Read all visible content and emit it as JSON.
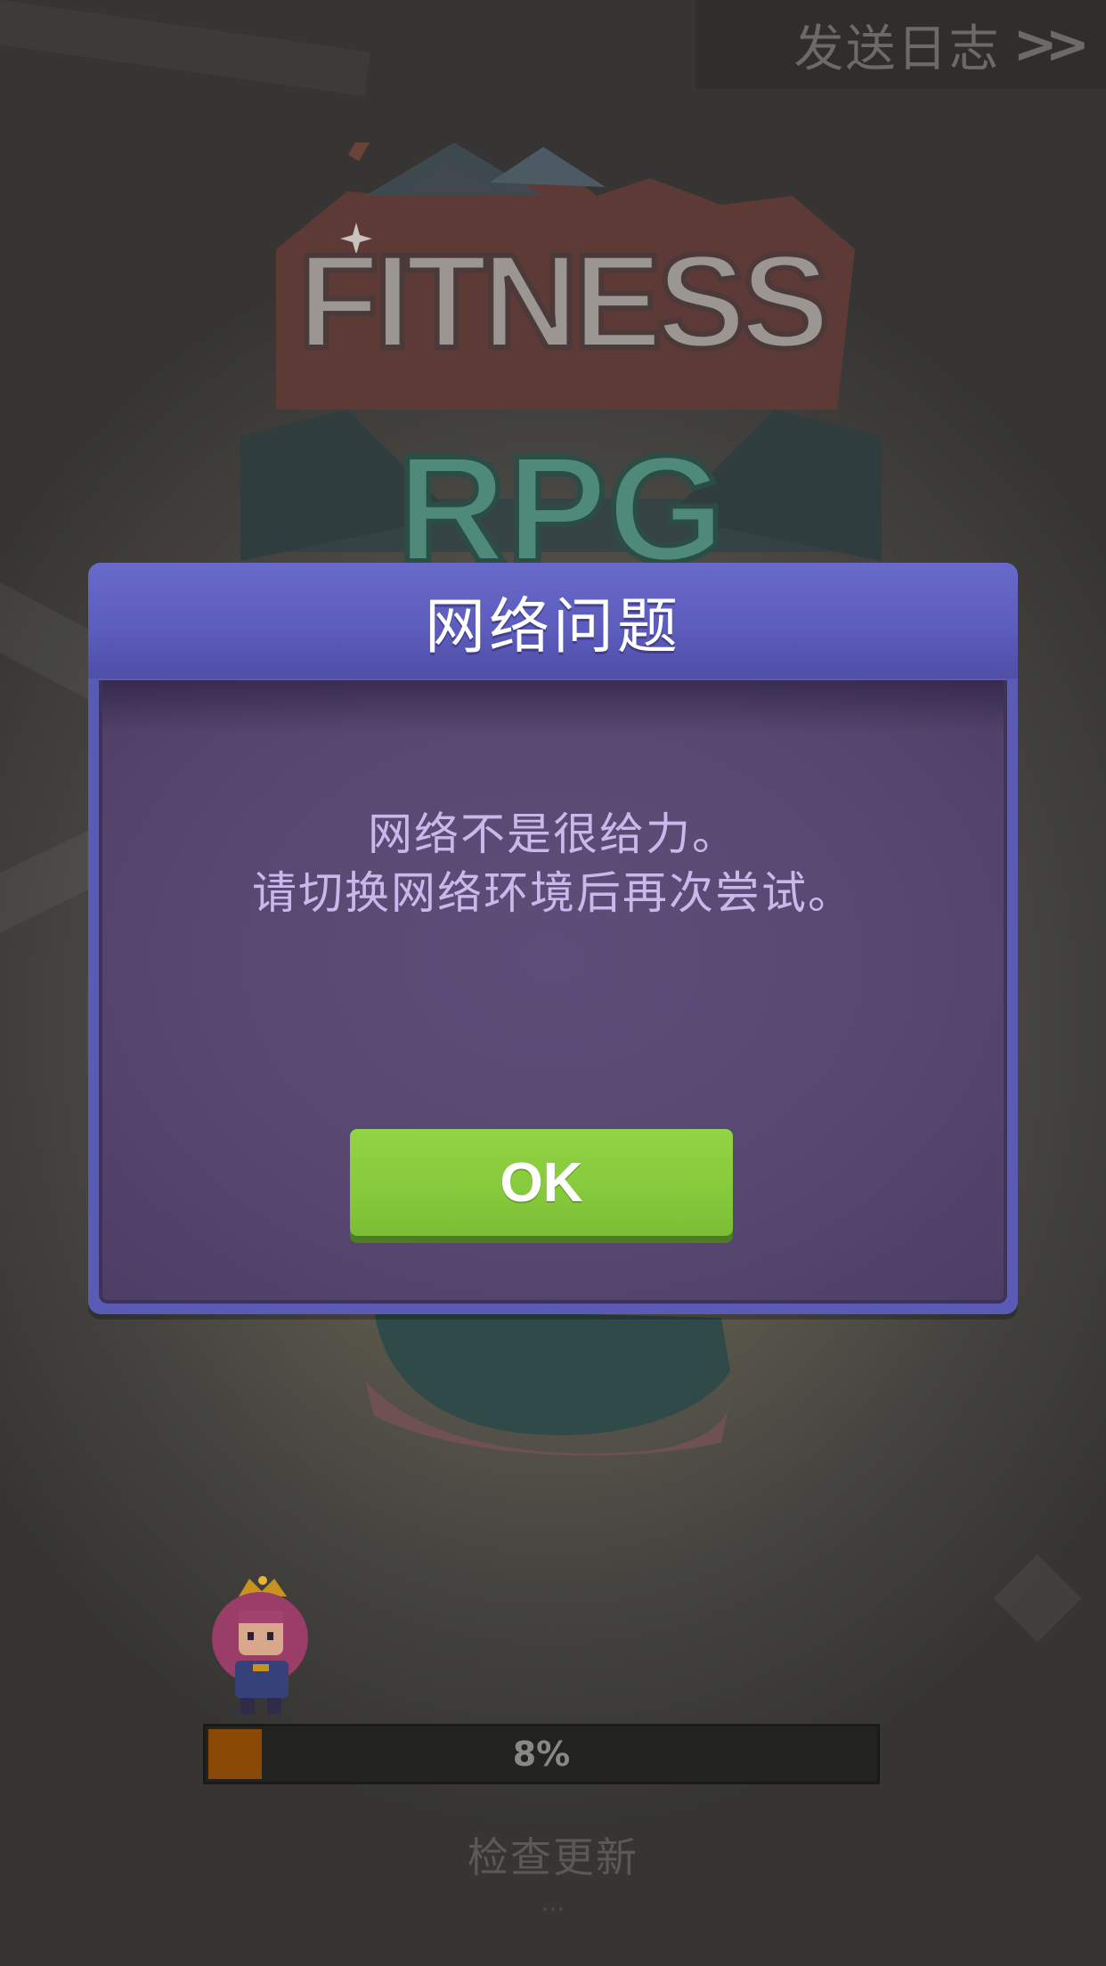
{
  "topbar": {
    "send_log_label": "发送日志",
    "send_log_icon": "double-chevron-right-icon"
  },
  "logo": {
    "line1": "FITNESS",
    "line2": "RPG"
  },
  "loading": {
    "progress_percent": 8,
    "progress_label": "8%",
    "status_text": "检查更新",
    "dots": "..."
  },
  "dialog": {
    "title": "网络问题",
    "message_line1": "网络不是很给力。",
    "message_line2": "请切换网络环境后再次尝试。",
    "ok_label": "OK"
  },
  "colors": {
    "dialog_header": "#5c5dbd",
    "dialog_body": "#574770",
    "ok_button": "#86c93c",
    "progress_fill": "#8a4a05",
    "message_text": "#c9b8ec"
  }
}
